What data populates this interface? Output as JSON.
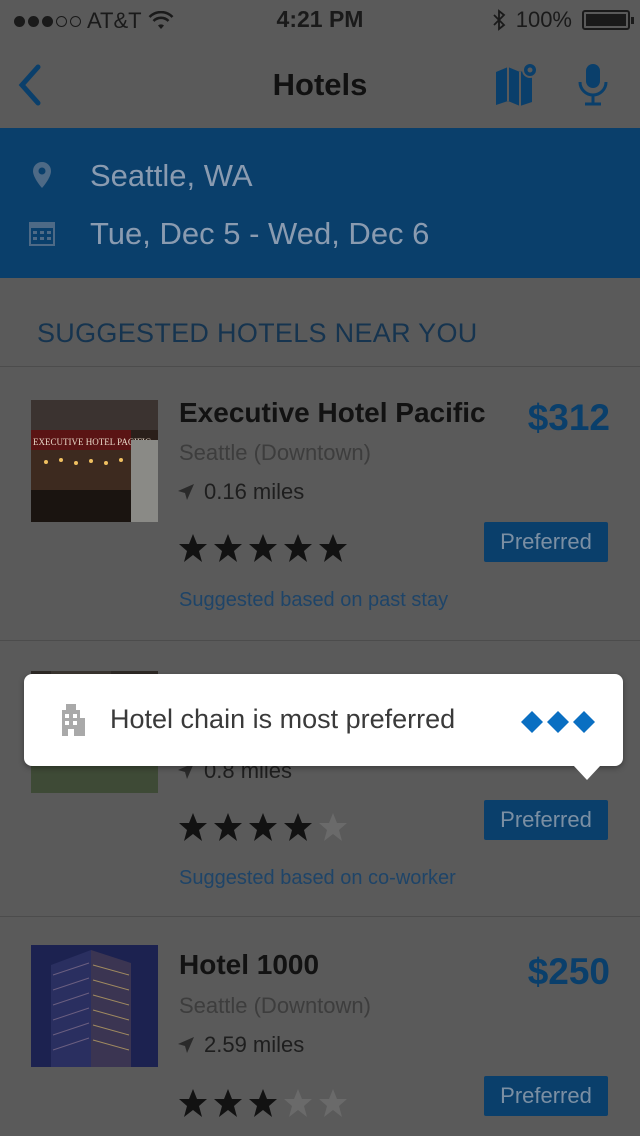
{
  "status": {
    "carrier": "AT&T",
    "time": "4:21 PM",
    "battery": "100%",
    "signal_bars_filled": 3,
    "signal_bars_total": 5
  },
  "navbar": {
    "title": "Hotels",
    "back_icon": "chevron-left-icon",
    "map_icon": "map-pin-icon",
    "mic_icon": "microphone-icon"
  },
  "search": {
    "location": "Seattle, WA",
    "dates": "Tue, Dec 5 - Wed,  Dec 6",
    "location_icon": "location-pin-icon",
    "date_icon": "calendar-icon"
  },
  "section_title": "SUGGESTED HOTELS NEAR YOU",
  "hotels": [
    {
      "name": "Executive Hotel Pacific",
      "location": "Seattle (Downtown)",
      "distance": "0.16 miles",
      "price": "$312",
      "rating": 5,
      "badge": "Preferred",
      "suggestion": "Suggested based on past stay",
      "sign_text": "EXECUTIVE HOTEL PACIFIC"
    },
    {
      "name": "",
      "location": "",
      "distance": "0.8 miles",
      "price": "",
      "rating": 4,
      "badge": "Preferred",
      "suggestion": "Suggested based on co-worker"
    },
    {
      "name": "Hotel 1000",
      "location": "Seattle (Downtown)",
      "distance": "2.59 miles",
      "price": "$250",
      "rating": 3,
      "badge": "Preferred",
      "suggestion": ""
    }
  ],
  "tooltip": {
    "message": "Hotel chain is most preferred",
    "icon": "building-icon",
    "level": 3
  },
  "colors": {
    "accent": "#0a3f6b",
    "link": "#1e4468",
    "tooltip_diamond": "#0a6fc2",
    "overlay": "#5a5a5a"
  }
}
